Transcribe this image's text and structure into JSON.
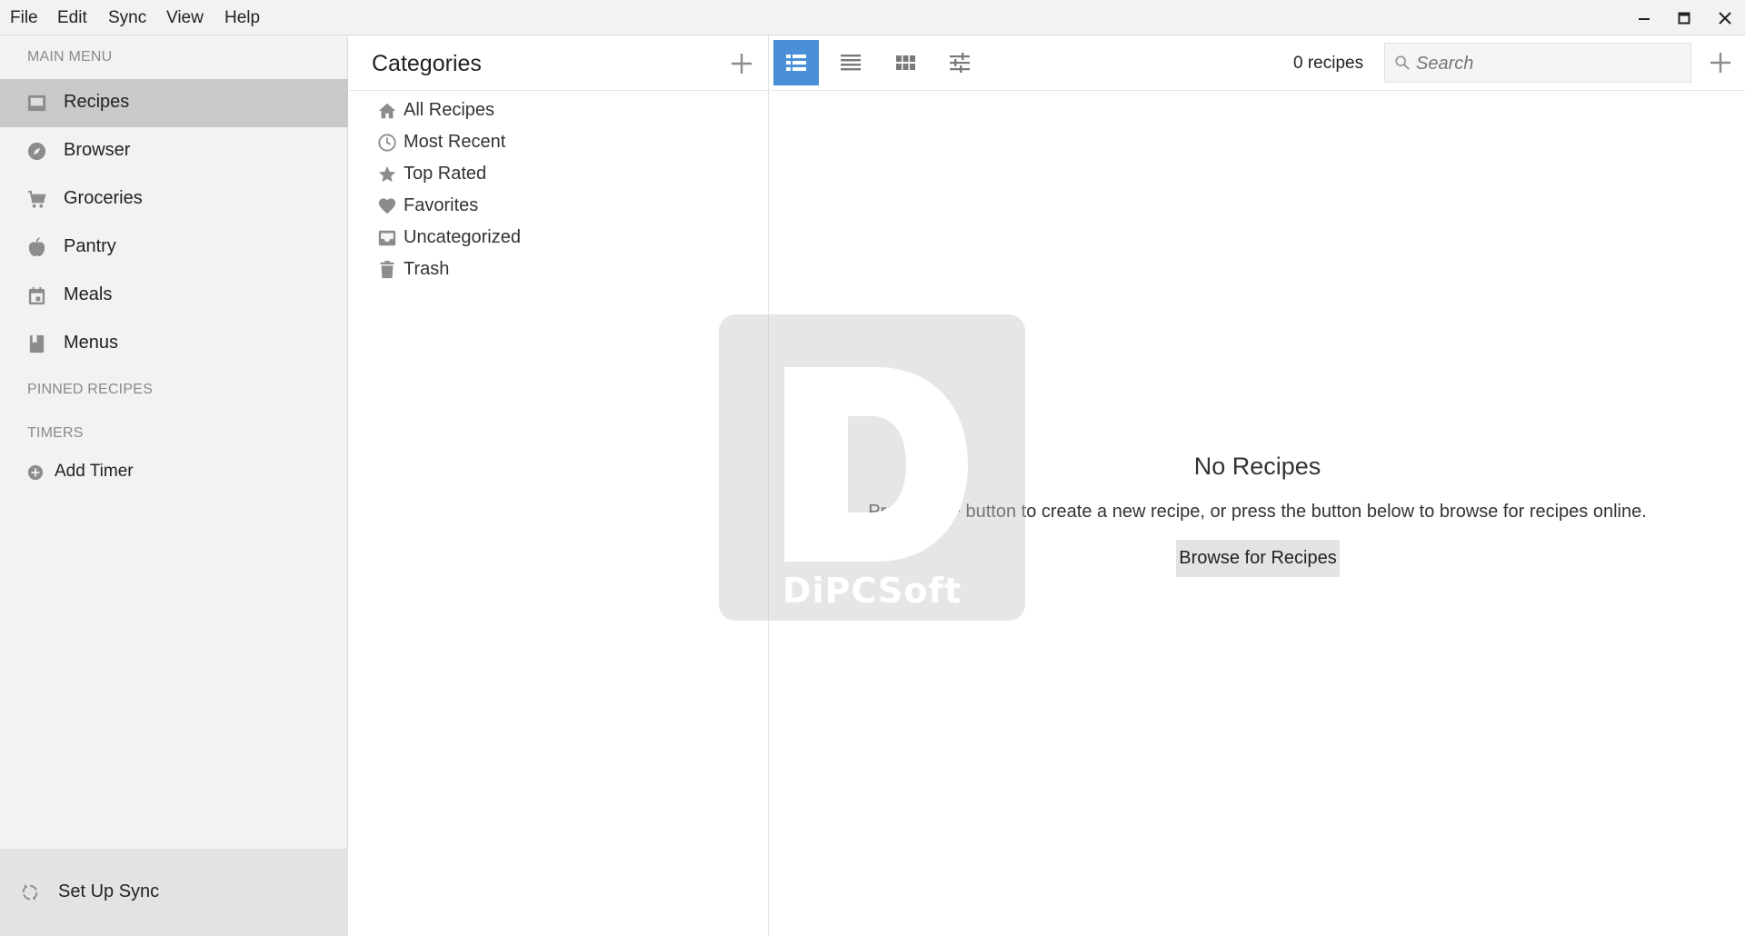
{
  "menubar": {
    "items": [
      "File",
      "Edit",
      "Sync",
      "View",
      "Help"
    ]
  },
  "sidebar": {
    "main_menu_header": "MAIN MENU",
    "items": [
      {
        "label": "Recipes",
        "icon": "recipes-icon",
        "selected": true
      },
      {
        "label": "Browser",
        "icon": "compass-icon",
        "selected": false
      },
      {
        "label": "Groceries",
        "icon": "cart-icon",
        "selected": false
      },
      {
        "label": "Pantry",
        "icon": "apple-icon",
        "selected": false
      },
      {
        "label": "Meals",
        "icon": "calendar-icon",
        "selected": false
      },
      {
        "label": "Menus",
        "icon": "book-icon",
        "selected": false
      }
    ],
    "pinned_header": "PINNED RECIPES",
    "timers_header": "TIMERS",
    "add_timer_label": "Add Timer",
    "sync_label": "Set Up Sync"
  },
  "categories": {
    "title": "Categories",
    "items": [
      {
        "label": "All Recipes",
        "icon": "home-icon"
      },
      {
        "label": "Most Recent",
        "icon": "clock-icon"
      },
      {
        "label": "Top Rated",
        "icon": "star-icon"
      },
      {
        "label": "Favorites",
        "icon": "heart-icon"
      },
      {
        "label": "Uncategorized",
        "icon": "inbox-icon"
      },
      {
        "label": "Trash",
        "icon": "trash-icon"
      }
    ]
  },
  "main": {
    "recipe_count": "0 recipes",
    "search_placeholder": "Search",
    "empty_title": "No Recipes",
    "empty_text": "Press the + button to create a new recipe, or press the button below to browse for recipes online.",
    "browse_button": "Browse for Recipes",
    "active_view": "list-detail"
  },
  "watermark": {
    "text": "DiPCSoft"
  },
  "colors": {
    "accent": "#4a90d9",
    "sidebar_bg": "#f2f2f2",
    "selected_bg": "#c9c9c9",
    "icon_gray": "#8c8c8c"
  }
}
